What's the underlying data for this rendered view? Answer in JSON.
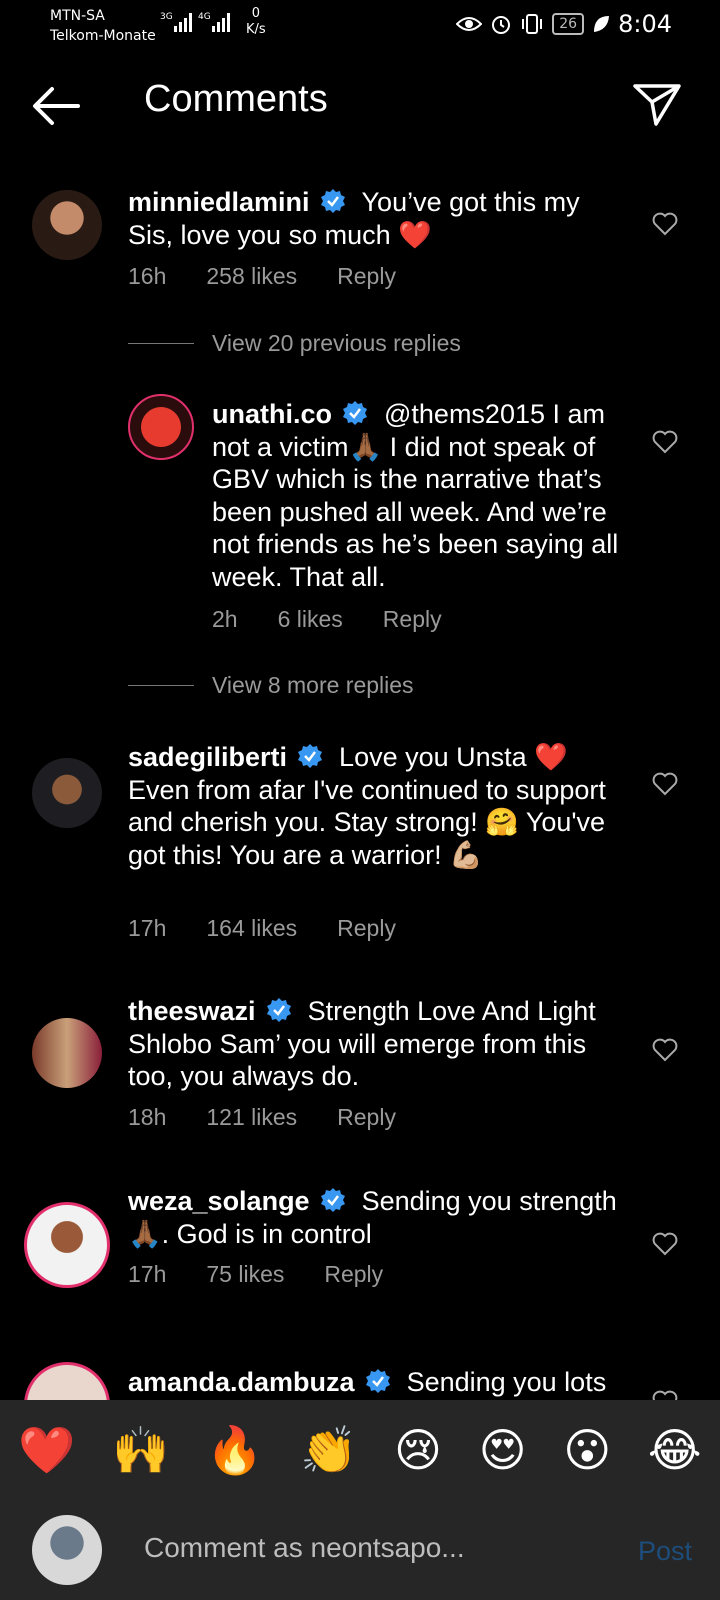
{
  "status_bar": {
    "carrier1": "MTN-SA",
    "carrier2": "Telkom-Monate",
    "net": "3G 4G",
    "speed_value": "0",
    "speed_unit": "K/s",
    "battery": "26",
    "time": "8:04"
  },
  "header": {
    "title": "Comments"
  },
  "comments": [
    {
      "username": "minniedlamini",
      "text": "You’ve got this my Sis, love you so much",
      "emoji": "❤️",
      "time": "16h",
      "likes": "258 likes",
      "reply": "Reply"
    },
    {
      "view_previous": "View 20 previous replies"
    },
    {
      "username": "unathi.co",
      "text": "@thems2015 I am not a victim🙏🏾 I did not speak of GBV which is the narrative that’s been pushed all week. And we’re not friends as he’s been saying all week. That all.",
      "time": "2h",
      "likes": "6 likes",
      "reply": "Reply"
    },
    {
      "view_more": "View 8 more replies"
    },
    {
      "username": "sadegiliberti",
      "text": "Love you Unsta ❤️ Even from afar I've continued to support and cherish you. Stay strong! 🤗 You've got this! You are a warrior! 💪🏼",
      "time": "17h",
      "likes": "164 likes",
      "reply": "Reply"
    },
    {
      "username": "theeswazi",
      "text": "Strength Love And Light Shlobo Sam’ you will emerge from this too, you always do.",
      "time": "18h",
      "likes": "121 likes",
      "reply": "Reply"
    },
    {
      "username": "weza_solange",
      "text": "Sending you strength 🙏🏾. God is in control",
      "time": "17h",
      "likes": "75 likes",
      "reply": "Reply"
    },
    {
      "username": "amanda.dambuza",
      "text": "Sending you lots"
    }
  ],
  "reactions": [
    "❤️",
    "🙌",
    "🔥",
    "👏",
    "😢",
    "😍",
    "😮",
    "😂"
  ],
  "compose": {
    "placeholder": "Comment as neontsapo...",
    "post_label": "Post"
  },
  "colors": {
    "accent": "#1d4d7a",
    "verified": "#3897f0",
    "muted": "#9a9a9a"
  }
}
